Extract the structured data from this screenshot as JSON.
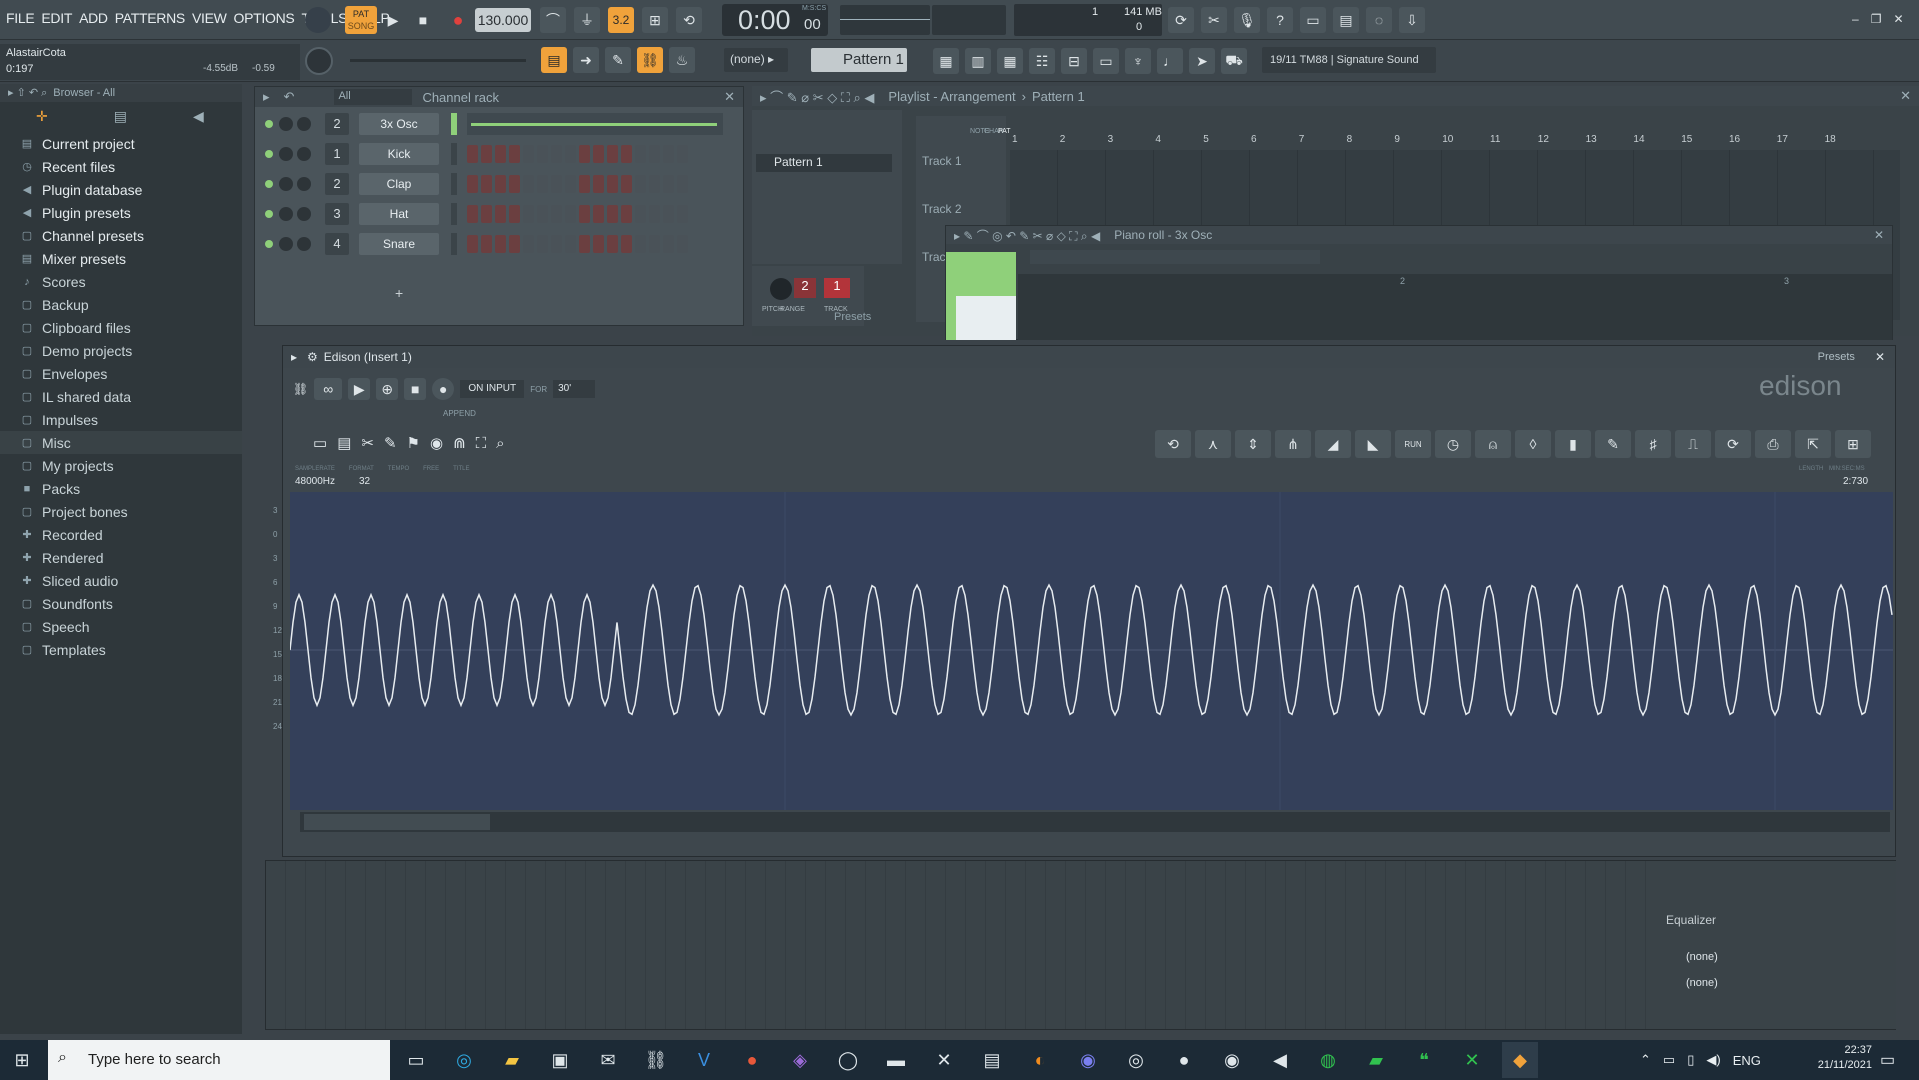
{
  "menu": [
    "FILE",
    "EDIT",
    "ADD",
    "PATTERNS",
    "VIEW",
    "OPTIONS",
    "TOOLS",
    "HELP"
  ],
  "transport": {
    "pat_label": "PAT",
    "song_label": "SONG",
    "tempo": "130.000",
    "time": "0:00",
    "time_sub": "00",
    "time_unit": "M:S:CS",
    "num_3": "3.2",
    "cpu": "1",
    "mem": "141 MB",
    "mem2": "0"
  },
  "hint": {
    "name": "AlastairCota",
    "value": "0:197",
    "level": "-4.55dB",
    "pan": "-0.59"
  },
  "toolbar2": {
    "pattern_select": "(none)",
    "pattern": "Pattern 1",
    "news": "19/11  TM88 | Signature Sound"
  },
  "browser": {
    "title": "Browser - All",
    "items": [
      {
        "icon": "▤",
        "label": "Current project"
      },
      {
        "icon": "◷",
        "label": "Recent files"
      },
      {
        "icon": "◀",
        "label": "Plugin database"
      },
      {
        "icon": "◀",
        "label": "Plugin presets"
      },
      {
        "icon": "▢",
        "label": "Channel presets"
      },
      {
        "icon": "▤",
        "label": "Mixer presets"
      },
      {
        "icon": "♪",
        "label": "Scores"
      },
      {
        "icon": "▢",
        "label": "Backup"
      },
      {
        "icon": "▢",
        "label": "Clipboard files"
      },
      {
        "icon": "▢",
        "label": "Demo projects"
      },
      {
        "icon": "▢",
        "label": "Envelopes"
      },
      {
        "icon": "▢",
        "label": "IL shared data"
      },
      {
        "icon": "▢",
        "label": "Impulses"
      },
      {
        "icon": "▢",
        "label": "Misc"
      },
      {
        "icon": "▢",
        "label": "My projects"
      },
      {
        "icon": "■",
        "label": "Packs"
      },
      {
        "icon": "▢",
        "label": "Project bones"
      },
      {
        "icon": "✚",
        "label": "Recorded"
      },
      {
        "icon": "✚",
        "label": "Rendered"
      },
      {
        "icon": "✚",
        "label": "Sliced audio"
      },
      {
        "icon": "▢",
        "label": "Soundfonts"
      },
      {
        "icon": "▢",
        "label": "Speech"
      },
      {
        "icon": "▢",
        "label": "Templates"
      }
    ]
  },
  "rack": {
    "title": "Channel rack",
    "filter": "All",
    "channels": [
      {
        "num": "2",
        "name": "3x Osc"
      },
      {
        "num": "1",
        "name": "Kick"
      },
      {
        "num": "2",
        "name": "Clap"
      },
      {
        "num": "3",
        "name": "Hat"
      },
      {
        "num": "4",
        "name": "Snare"
      }
    ],
    "add": "+"
  },
  "playlist": {
    "title": "Playlist - Arrangement",
    "pattern": "Pattern 1",
    "pattern_item": "Pattern 1",
    "tracks": [
      "Track 1",
      "Track 2",
      "Trac"
    ],
    "bars": [
      "1",
      "2",
      "3",
      "4",
      "5",
      "6",
      "7",
      "8",
      "9",
      "10",
      "11",
      "12",
      "13",
      "14",
      "15",
      "16",
      "17",
      "18"
    ],
    "cols": [
      "NOTE",
      "CHAN",
      "PAT"
    ],
    "presets": "Presets",
    "pitch_label": "PITCH",
    "range_label": "RANGE",
    "track_label": "TRACK",
    "pitch_val": "2",
    "track_val": "1"
  },
  "pianoroll": {
    "title": "Piano roll - 3x Osc",
    "markers": [
      "2",
      "3"
    ]
  },
  "edison": {
    "title": "Edison (Insert 1)",
    "presets": "Presets",
    "logo": "edison",
    "rec_mode": "ON INPUT",
    "for": "FOR",
    "for_val": "30'",
    "append": "APPEND",
    "labels": [
      "SAMPLERATE",
      "FORMAT",
      "TEMPO",
      "FREE",
      "TITLE",
      "LENGTH",
      "MIN:SEC:MS"
    ],
    "samplerate": "48000Hz",
    "format": "32",
    "length": "2:730",
    "run": "RUN",
    "scale": [
      "3",
      "0",
      "3",
      "6",
      "9",
      "12",
      "15",
      "18",
      "21",
      "24"
    ]
  },
  "mixer": {
    "equalizer": "Equalizer",
    "slot1": "(none)",
    "slot2": "(none)"
  },
  "taskbar": {
    "search": "Type here to search",
    "lang": "ENG",
    "time": "22:37",
    "date": "21/11/2021"
  }
}
